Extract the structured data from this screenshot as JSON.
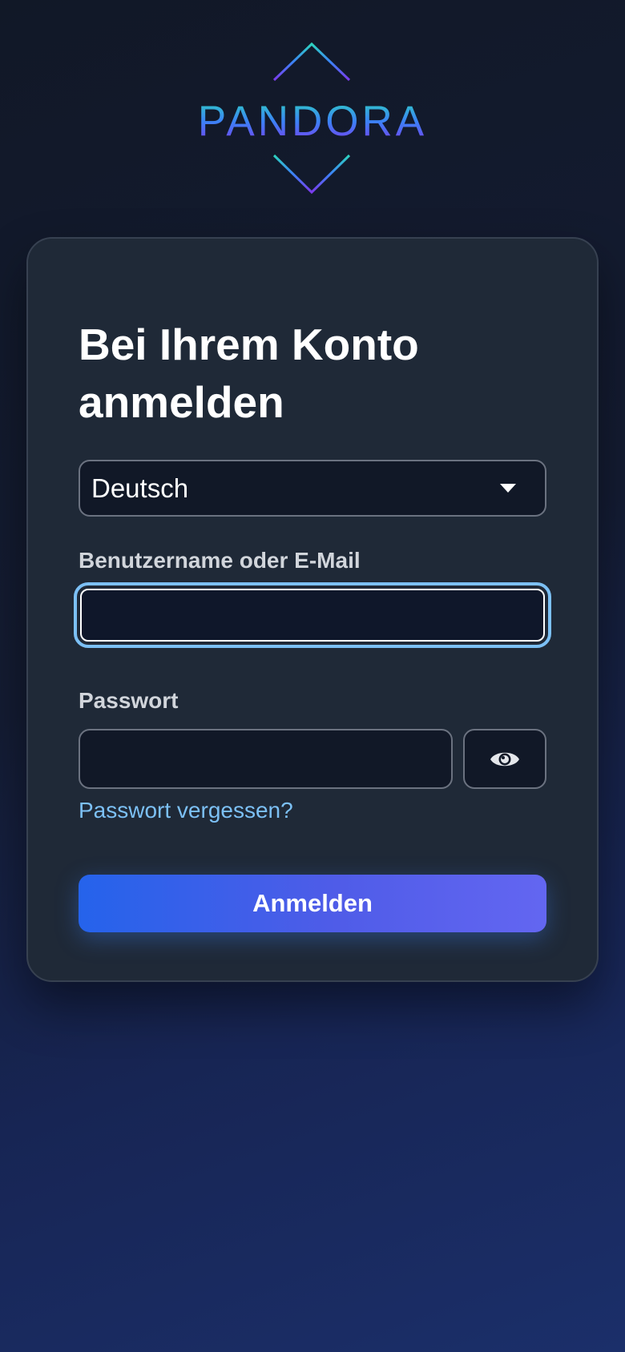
{
  "brand": {
    "name": "PANDORA"
  },
  "login": {
    "title": "Bei Ihrem Konto anmelden",
    "language": {
      "selected": "Deutsch"
    },
    "username": {
      "label": "Benutzername oder E-Mail",
      "value": "",
      "focused": true
    },
    "password": {
      "label": "Passwort",
      "value": "",
      "toggle_icon": "eye-icon"
    },
    "forgot_link": "Passwort vergessen?",
    "submit_label": "Anmelden"
  },
  "colors": {
    "background": "#111827",
    "card": "#1f2937",
    "input_bg": "#111827",
    "focus_ring": "#7cc0f5",
    "link": "#7cc0f5",
    "button_gradient_start": "#2563eb",
    "button_gradient_end": "#6366f1",
    "logo_gradient_start": "#2dd4bf",
    "logo_gradient_end": "#7c3aed"
  }
}
